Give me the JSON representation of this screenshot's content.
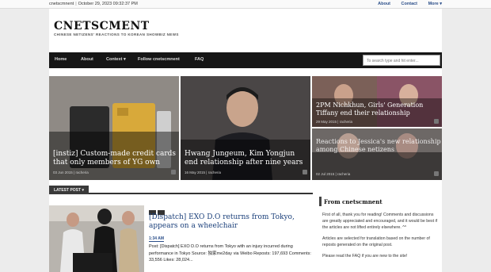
{
  "topbar": {
    "site": "cnetscmnent",
    "datetime": "October 29, 2023 09:32:37 PM",
    "links": [
      "About",
      "Contact",
      "More ▾"
    ]
  },
  "masthead": {
    "title": "CNETSCMENT",
    "tagline": "CHINESE NETIZENS' REACTIONS TO KOREAN SHOWBIZ NEWS"
  },
  "nav": {
    "items": [
      "Home",
      "About",
      "Context ▾",
      "Follow cnetscmnent",
      "FAQ"
    ],
    "search_placeholder": "To search type and hit enter..."
  },
  "features": [
    {
      "title": "[instiz] Custom-made credit cards that only members of YG own",
      "date": "03 Jun 2015",
      "author": "racheria"
    },
    {
      "title": "Hwang Jungeum, Kim Yongjun end relationship after nine years",
      "date": "16 May 2015",
      "author": "racheria"
    },
    {
      "title": "2PM Nichkhun, Girls' Generation Tiffany end their relationship",
      "date": "29 May 2015",
      "author": "racheria"
    },
    {
      "title": "Reactions to Jessica's new relationship among Chinese netizens",
      "date": "02 Jul 2015",
      "author": "racheria"
    }
  ],
  "latest": {
    "tab_label": "LATEST POST ▾",
    "post_title": "[Dispatch] EXO D.O returns from Tokyo, appears on a wheelchair",
    "time": "1:34 AM",
    "excerpt": "Post: [Dispatch] EXO D.O returns from Tokyo with an injury incurred during performance in Tokyo Source: 独家me2day via Weibo Reposts: 197,693 Comments: 33,556 Likes: 28,024..."
  },
  "sidebar": {
    "heading": "From cnetscmnent",
    "paragraphs": [
      "First of all, thank you for reading! Comments and discussions are greatly appreciated and encouraged, and it would be best if the articles are not lifted entirely elsewhere. ^^",
      "Articles are selected for translation based on the number of reposts generated on the original post.",
      "Please read the FAQ if you are new to the site!"
    ]
  },
  "colors": {
    "nav_bg": "#161616",
    "link": "#2c4f8a",
    "post_title": "#1a3f7a"
  }
}
